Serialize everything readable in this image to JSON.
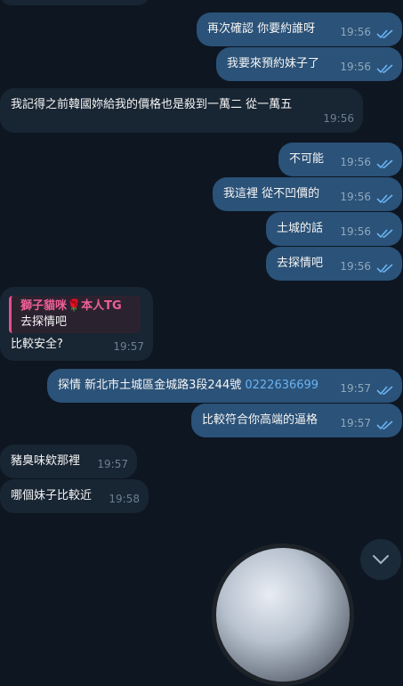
{
  "colors": {
    "background": "#0e1621",
    "outgoing_bubble": "#2b5278",
    "incoming_bubble": "#182533",
    "read_check": "#6ab3f3",
    "quote_name": "#ee5f96"
  },
  "messages": [
    {
      "direction": "out",
      "text": "再次確認  你要約誰呀",
      "time": "19:56",
      "read": true
    },
    {
      "direction": "out",
      "text": "我要來預約妹子了",
      "time": "19:56",
      "read": true
    },
    {
      "direction": "in",
      "text": "我記得之前韓國妳給我的價格也是殺到一萬二 從一萬五",
      "time": "19:56"
    },
    {
      "direction": "out",
      "text": "不可能",
      "time": "19:56",
      "read": true
    },
    {
      "direction": "out",
      "text": "我這裡 從不凹價的",
      "time": "19:56",
      "read": true
    },
    {
      "direction": "out",
      "text": "土城的話",
      "time": "19:56",
      "read": true
    },
    {
      "direction": "out",
      "text": "去探情吧",
      "time": "19:56",
      "read": true
    },
    {
      "direction": "in",
      "quote_name": "獅子貓咪🌹本人TG",
      "quote_text": "去探情吧",
      "text": "比較安全?",
      "time": "19:57"
    },
    {
      "direction": "out",
      "text": "探情 新北市土城區金城路3段244號 ",
      "link": "0222636699",
      "time": "19:57",
      "read": true
    },
    {
      "direction": "out",
      "text": "比較符合你高端的逼格",
      "time": "19:57",
      "read": true
    },
    {
      "direction": "in",
      "text": "豬臭味欸那裡",
      "time": "19:57"
    },
    {
      "direction": "in",
      "text": "哪個妹子比較近",
      "time": "19:58"
    }
  ],
  "scroll_button": {
    "icon": "chevron-down-icon"
  }
}
